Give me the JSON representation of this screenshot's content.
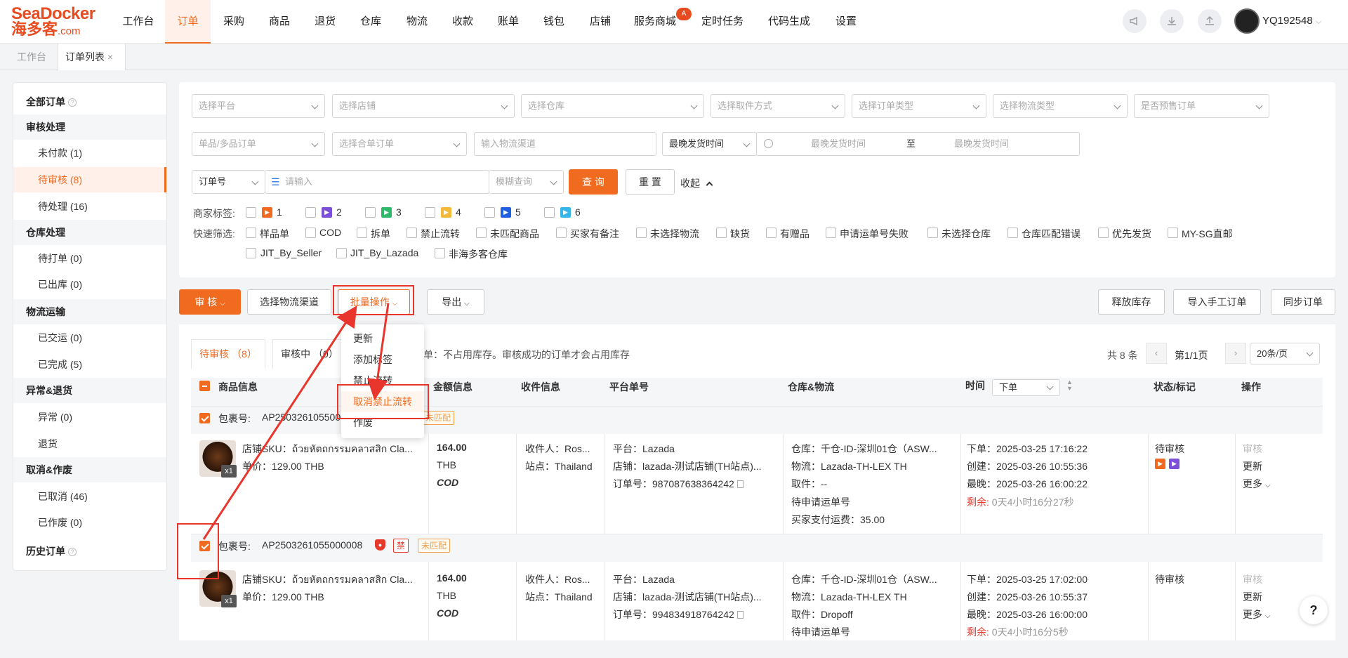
{
  "header": {
    "logo_brand": "SeaDocker",
    "logo_cn": "海多客",
    "logo_domain": ".com",
    "nav": [
      {
        "label": "工作台"
      },
      {
        "label": "订单"
      },
      {
        "label": "采购"
      },
      {
        "label": "商品"
      },
      {
        "label": "退货"
      },
      {
        "label": "仓库"
      },
      {
        "label": "物流"
      },
      {
        "label": "收款"
      },
      {
        "label": "账单"
      },
      {
        "label": "钱包"
      },
      {
        "label": "店铺"
      },
      {
        "label": "服务商城"
      },
      {
        "label": "定时任务"
      },
      {
        "label": "代码生成"
      },
      {
        "label": "设置"
      }
    ],
    "service_badge": "A",
    "icons": [
      "announcement-icon",
      "download-icon",
      "upload-icon"
    ],
    "username": "YQ192548",
    "accent_color": "#f06a1f"
  },
  "page_tabs": [
    {
      "label": "工作台"
    },
    {
      "label": "订单列表"
    }
  ],
  "page_tab_close": "×",
  "sidebar": {
    "all_orders": "全部订单",
    "groups": [
      {
        "title": "审核处理",
        "items": [
          {
            "label": "未付款 (1)"
          },
          {
            "label": "待审核 (8)"
          },
          {
            "label": "待处理 (16)"
          }
        ]
      },
      {
        "title": "仓库处理",
        "items": [
          {
            "label": "待打单 (0)"
          },
          {
            "label": "已出库 (0)"
          }
        ]
      },
      {
        "title": "物流运输",
        "items": [
          {
            "label": "已交运 (0)"
          },
          {
            "label": "已完成 (5)"
          }
        ]
      },
      {
        "title": "异常&退货",
        "items": [
          {
            "label": "异常 (0)"
          },
          {
            "label": "退货"
          }
        ]
      },
      {
        "title": "取消&作废",
        "items": [
          {
            "label": "已取消 (46)"
          },
          {
            "label": "已作废 (0)"
          }
        ]
      }
    ],
    "history": "历史订单"
  },
  "filters": {
    "row1": [
      "选择平台",
      "选择店铺",
      "选择仓库",
      "选择取件方式",
      "选择订单类型",
      "选择物流类型",
      "是否预售订单"
    ],
    "row2": {
      "item_type": "单品/多品订单",
      "merge": "选择合单订单",
      "channel_placeholder": "输入物流渠道",
      "time_type": "最晚发货时间",
      "start_placeholder": "最晚发货时间",
      "to": "至",
      "end_placeholder": "最晚发货时间"
    },
    "row3": {
      "field": "订单号",
      "search_placeholder": "请输入",
      "match": "模糊查询",
      "query": "查 询",
      "reset": "重 置",
      "collapse": "收起"
    },
    "merchant_tags_label": "商家标签:",
    "merchant_tags": [
      {
        "label": "1",
        "color": "#f06a1f"
      },
      {
        "label": "2",
        "color": "#7b4fd8"
      },
      {
        "label": "3",
        "color": "#2fb96b"
      },
      {
        "label": "4",
        "color": "#f5b93a"
      },
      {
        "label": "5",
        "color": "#1f5fe0"
      },
      {
        "label": "6",
        "color": "#36b5e8"
      }
    ],
    "quick_label": "快速筛选:",
    "quick": [
      "样品单",
      "COD",
      "拆单",
      "禁止流转",
      "未匹配商品",
      "买家有备注",
      "未选择物流",
      "缺货",
      "有赠品",
      "申请运单号失败",
      "未选择仓库",
      "仓库匹配错误",
      "优先发货",
      "MY-SG直邮",
      "JIT_By_Seller",
      "JIT_By_Lazada",
      "非海多客仓库"
    ]
  },
  "actions": {
    "audit": "审 核",
    "select_channel": "选择物流渠道",
    "batch": "批量操作",
    "export": "导出",
    "release": "释放库存",
    "import_manual": "导入手工订单",
    "sync": "同步订单"
  },
  "batch_menu": [
    "更新",
    "添加标签",
    "禁止流转",
    "取消禁止流转",
    "作废"
  ],
  "list": {
    "tabs": [
      {
        "label": "待审核 （8）"
      },
      {
        "label": "审核中 （0）"
      }
    ],
    "hint": "单：不占用库存。审核成功的订单才会占用库存",
    "total": "共 8 条",
    "page": "第1/1页",
    "page_size": "20条/页",
    "columns": [
      "商品信息",
      "金额信息",
      "收件信息",
      "平台单号",
      "仓库&物流",
      "时间",
      "状态/标记",
      "操作"
    ],
    "time_sort": "下单",
    "package_label": "包裹号:",
    "orders": [
      {
        "package_no": "AP2503261055000",
        "unmatched": "未匹配",
        "sku": "店铺SKU：ถ้วยหัตถกรรมคลาสสิก Cla...",
        "unit_price": "单价：129.00 THB",
        "qty": "x1",
        "amount": "164.00",
        "currency": "THB",
        "cod": "COD",
        "receiver": "收件人：Ros...",
        "site": "站点：Thailand",
        "platform": "平台：Lazada",
        "store": "店铺：lazada-测试店铺(TH站点)...",
        "order_no": "订单号：987087638364242",
        "warehouse": "仓库：千仓-ID-深圳01仓（ASW...",
        "logistics": "物流：Lazada-TH-LEX TH",
        "pickup": "取件：--",
        "waybill": "待申请运单号",
        "shipping_fee": "买家支付运费：35.00",
        "placed": "下单：2025-03-25 17:16:22",
        "created": "创建：2025-03-26 10:55:36",
        "latest": "最晚：2025-03-26 16:00:22",
        "remain_label": "剩余:",
        "remain": "0天4小时16分27秒",
        "status": "待审核",
        "ops": [
          "审核",
          "更新",
          "更多"
        ]
      },
      {
        "package_no": "AP2503261055000008",
        "forbidden": "禁",
        "unmatched": "未匹配",
        "sku": "店铺SKU：ถ้วยหัตถกรรมคลาสสิก Cla...",
        "unit_price": "单价：129.00 THB",
        "qty": "x1",
        "amount": "164.00",
        "currency": "THB",
        "cod": "COD",
        "receiver": "收件人：Ros...",
        "site": "站点：Thailand",
        "platform": "平台：Lazada",
        "store": "店铺：lazada-测试店铺(TH站点)...",
        "order_no": "订单号：994834918764242",
        "warehouse": "仓库：千仓-ID-深圳01仓（ASW...",
        "logistics": "物流：Lazada-TH-LEX TH",
        "pickup": "取件：Dropoff",
        "waybill": "待申请运单号",
        "placed": "下单：2025-03-25 17:02:00",
        "created": "创建：2025-03-26 10:55:37",
        "latest": "最晚：2025-03-26 16:00:00",
        "remain_label": "剩余:",
        "remain": "0天4小时16分5秒",
        "status": "待审核",
        "ops": [
          "审核",
          "更新",
          "更多"
        ]
      }
    ]
  },
  "help": "?"
}
